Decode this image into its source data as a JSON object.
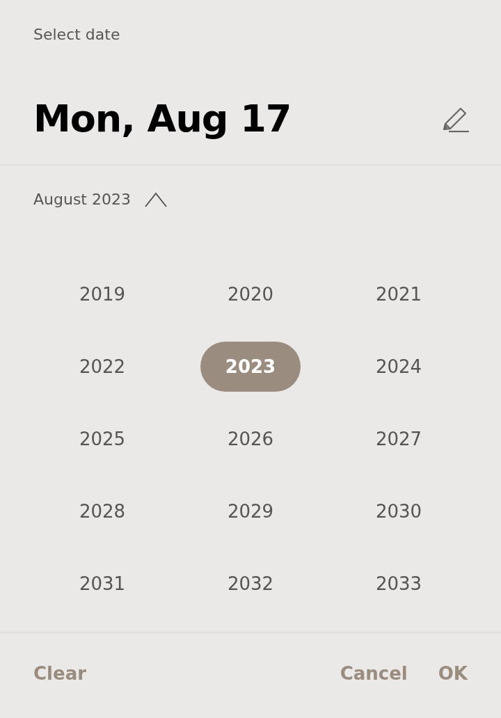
{
  "header": {
    "label": "Select date",
    "selected_date": "Mon, Aug 17"
  },
  "month_picker": {
    "label": "August 2023",
    "expanded": true
  },
  "years": [
    {
      "label": "2019",
      "selected": false
    },
    {
      "label": "2020",
      "selected": false
    },
    {
      "label": "2021",
      "selected": false
    },
    {
      "label": "2022",
      "selected": false
    },
    {
      "label": "2023",
      "selected": true
    },
    {
      "label": "2024",
      "selected": false
    },
    {
      "label": "2025",
      "selected": false
    },
    {
      "label": "2026",
      "selected": false
    },
    {
      "label": "2027",
      "selected": false
    },
    {
      "label": "2028",
      "selected": false
    },
    {
      "label": "2029",
      "selected": false
    },
    {
      "label": "2030",
      "selected": false
    },
    {
      "label": "2031",
      "selected": false
    },
    {
      "label": "2032",
      "selected": false
    },
    {
      "label": "2033",
      "selected": false
    }
  ],
  "buttons": {
    "left": [
      "Clear"
    ],
    "right": [
      "Cancel",
      "OK"
    ]
  }
}
